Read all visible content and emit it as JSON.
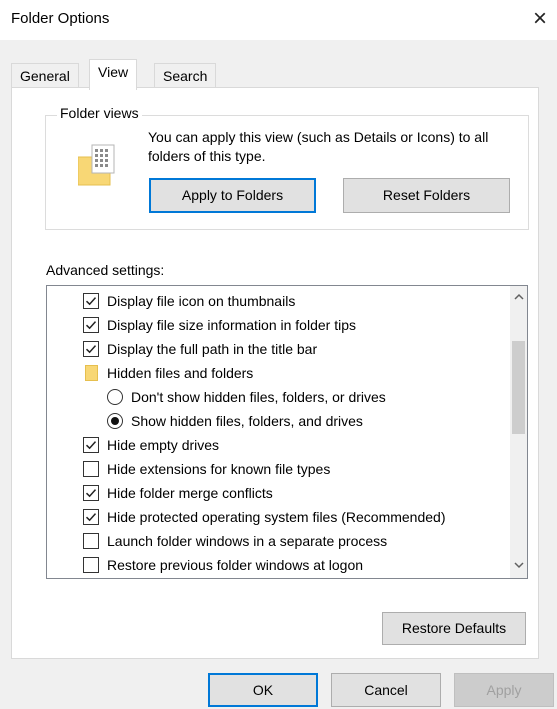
{
  "window": {
    "title": "Folder Options",
    "close_glyph": "×",
    "close_icon": "close-icon"
  },
  "tabs": [
    {
      "label": "General",
      "active": false
    },
    {
      "label": "View",
      "active": true
    },
    {
      "label": "Search",
      "active": false
    }
  ],
  "folder_views": {
    "legend": "Folder views",
    "description": "You can apply this view (such as Details or Icons) to all folders of this type.",
    "apply_button": "Apply to Folders",
    "reset_button": "Reset Folders"
  },
  "advanced": {
    "label": "Advanced settings:",
    "items": [
      {
        "type": "checkbox",
        "checked": true,
        "label": "Display file icon on thumbnails"
      },
      {
        "type": "checkbox",
        "checked": true,
        "label": "Display file size information in folder tips"
      },
      {
        "type": "checkbox",
        "checked": true,
        "label": "Display the full path in the title bar"
      },
      {
        "type": "folder",
        "label": "Hidden files and folders"
      },
      {
        "type": "radio",
        "checked": false,
        "label": "Don't show hidden files, folders, or drives"
      },
      {
        "type": "radio",
        "checked": true,
        "label": "Show hidden files, folders, and drives"
      },
      {
        "type": "checkbox",
        "checked": true,
        "label": "Hide empty drives"
      },
      {
        "type": "checkbox",
        "checked": false,
        "label": "Hide extensions for known file types"
      },
      {
        "type": "checkbox",
        "checked": true,
        "label": "Hide folder merge conflicts"
      },
      {
        "type": "checkbox",
        "checked": true,
        "label": "Hide protected operating system files (Recommended)"
      },
      {
        "type": "checkbox",
        "checked": false,
        "label": "Launch folder windows in a separate process"
      },
      {
        "type": "checkbox",
        "checked": false,
        "label": "Restore previous folder windows at logon"
      }
    ],
    "restore_defaults_button": "Restore Defaults"
  },
  "footer": {
    "ok": "OK",
    "cancel": "Cancel",
    "apply": "Apply"
  },
  "colors": {
    "accent": "#0078d7",
    "folder": "#f8d775"
  }
}
